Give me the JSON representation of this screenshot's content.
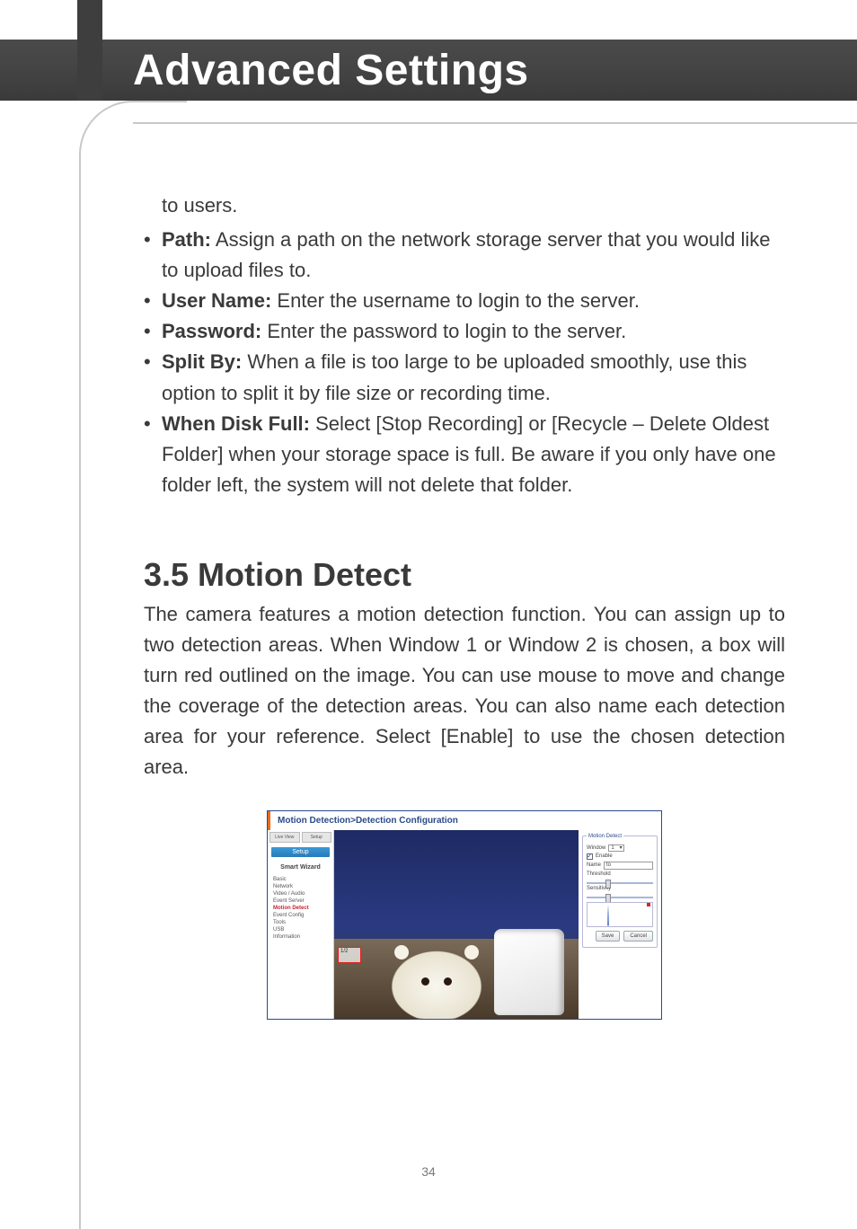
{
  "header": {
    "title": "Advanced Settings"
  },
  "fragment": "to users.",
  "bullets": [
    {
      "label": "Path:",
      "text": " Assign a path on the network storage server that you would like to upload files to."
    },
    {
      "label": "User Name:",
      "text": " Enter the username to login to the server."
    },
    {
      "label": "Password:",
      "text": " Enter the password to login to the server."
    },
    {
      "label": "Split By:",
      "text": " When a file is too large to be uploaded smoothly, use this option to split it by file size or recording time."
    },
    {
      "label": "When Disk Full:",
      "text": " Select [Stop Recording] or [Recycle – Delete Oldest Folder] when your storage space is full. Be aware if you only have one folder left, the system will not delete that folder."
    }
  ],
  "section": {
    "heading": "3.5 Motion Detect",
    "body": "The camera features a motion detection function. You can assign up to two detection areas. When Window 1 or Window 2 is chosen, a box will turn red outlined on the image. You can use mouse to move and change the coverage of the detection areas. You can also name each detection area for your reference. Select [Enable] to use the chosen detection area."
  },
  "screenshot": {
    "title": "Motion Detection>Detection Configuration",
    "setup_label": "Setup",
    "tabs": [
      "Live View",
      "Setup"
    ],
    "wizard_label": "Smart Wizard",
    "nav": [
      "Basic",
      "Network",
      "Video / Audio",
      "Event Server",
      "Motion Detect",
      "Event Config",
      "Tools",
      "USB",
      "Information"
    ],
    "nav_active_index": 4,
    "panel": {
      "legend": "Motion Detect",
      "window_label": "Window",
      "window_value": "1",
      "enable_label": "Enable",
      "name_label": "Name",
      "name_value": "to",
      "threshold_label": "Threshold",
      "sensitivity_label": "Sensitivity"
    },
    "redbox": "1/2",
    "buttons": {
      "save": "Save",
      "cancel": "Cancel"
    }
  },
  "page_number": "34"
}
